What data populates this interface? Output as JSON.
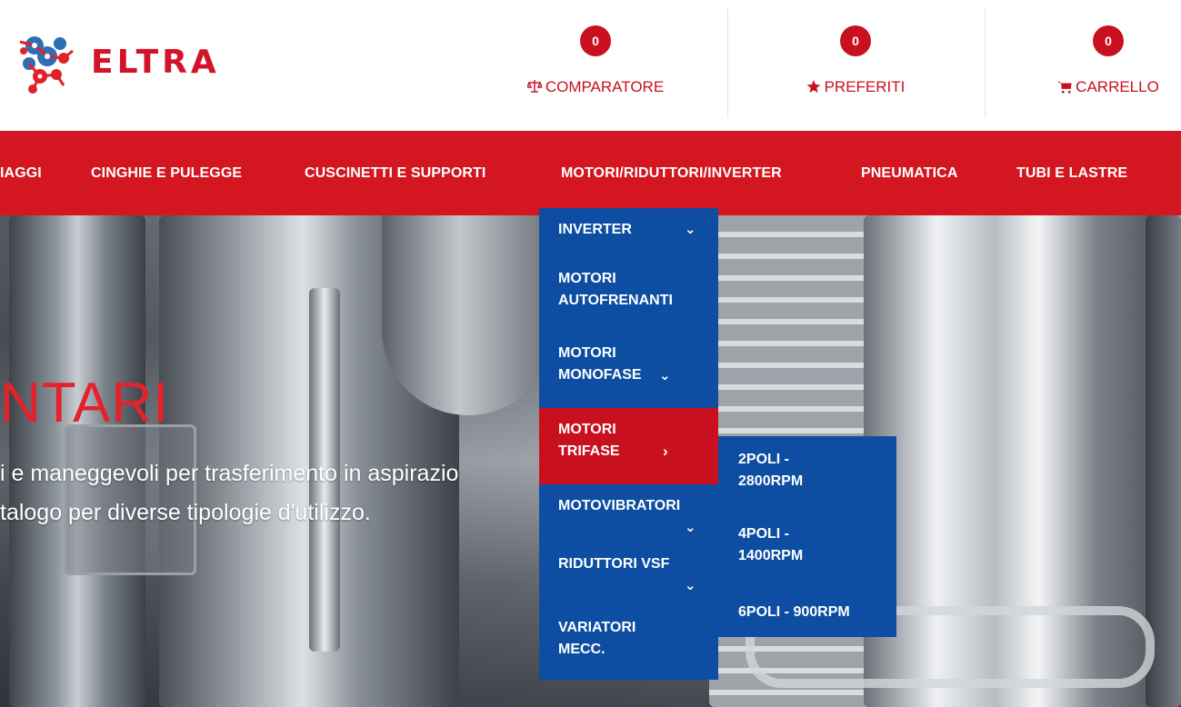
{
  "header": {
    "logo_text": "ELTRA",
    "comparatore": {
      "count": "0",
      "label": "COMPARATORE",
      "icon": "scale-icon"
    },
    "preferiti": {
      "count": "0",
      "label": "PREFERITI",
      "icon": "star-icon"
    },
    "carrello": {
      "count": "0",
      "label": "CARRELLO",
      "icon": "cart-icon"
    }
  },
  "nav": {
    "items": [
      "IAGGI",
      "CINGHIE E PULEGGE",
      "CUSCINETTI E SUPPORTI",
      "MOTORI/RIDUTTORI/INVERTER",
      "PNEUMATICA",
      "TUBI E LASTRE"
    ]
  },
  "hero": {
    "title": "NTARI",
    "line1": "i e maneggevoli per trasferimento in aspirazio",
    "line2": "talogo per diverse tipologie d'utilizzo."
  },
  "dropdown": {
    "items": [
      {
        "line1": "INVERTER",
        "line2": ""
      },
      {
        "line1": "MOTORI",
        "line2": "AUTOFRENANTI"
      },
      {
        "line1": "MOTORI",
        "line2": "MONOFASE"
      },
      {
        "line1": "MOTORI",
        "line2": "TRIFASE"
      },
      {
        "line1": "MOTOVIBRATORI",
        "line2": ""
      },
      {
        "line1": "RIDUTTORI VSF",
        "line2": ""
      },
      {
        "line1": "VARIATORI",
        "line2": "MECC."
      }
    ]
  },
  "submenu": {
    "items": [
      {
        "line1": "2POLI -",
        "line2": "2800RPM"
      },
      {
        "line1": "4POLI -",
        "line2": "1400RPM"
      },
      {
        "line1": "6POLI - 900RPM",
        "line2": ""
      }
    ]
  },
  "colors": {
    "brand_red": "#d3161f",
    "menu_blue": "#0d4ea3",
    "badge_red": "#c8101f"
  }
}
